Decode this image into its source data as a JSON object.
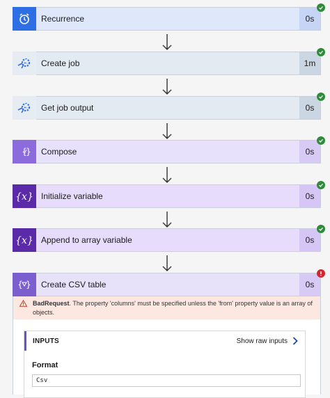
{
  "steps": [
    {
      "label": "Recurrence",
      "duration": "0s",
      "icon": "alarm-clock-icon",
      "status": "succeeded"
    },
    {
      "label": "Create job",
      "duration": "1m",
      "icon": "automation-gear-icon",
      "status": "succeeded"
    },
    {
      "label": "Get job output",
      "duration": "0s",
      "icon": "automation-gear-icon",
      "status": "succeeded"
    },
    {
      "label": "Compose",
      "duration": "0s",
      "icon": "compose-braces-icon",
      "status": "succeeded"
    },
    {
      "label": "Initialize variable",
      "duration": "0s",
      "icon": "variable-x-icon",
      "status": "succeeded"
    },
    {
      "label": "Append to array variable",
      "duration": "0s",
      "icon": "variable-x-icon",
      "status": "succeeded"
    },
    {
      "label": "Create CSV table",
      "duration": "0s",
      "icon": "csv-table-braces-icon",
      "status": "failed"
    }
  ],
  "error": {
    "title": "BadRequest",
    "message": ". The property 'columns' must be specified unless the 'from' property value is an array of objects."
  },
  "inputs": {
    "header": "INPUTS",
    "show_raw": "Show raw inputs",
    "format_label": "Format",
    "format_value": "Csv"
  },
  "colors": {
    "recurrence_icon": "#2f6fe6",
    "recurrence_bg": "#dfe8fb",
    "recurrence_dur": "#c6d5f6",
    "automation_icon_bg": "#e6ecf2",
    "automation_bg": "#e3eaf1",
    "automation_dur": "#cbd6e3",
    "compose_icon": "#8c6cdc",
    "compose_bg": "#e8e1fb",
    "compose_dur": "#d7cbf5",
    "variable_icon": "#5a2aa8",
    "variable_bg": "#e7dcfb",
    "variable_dur": "#d6c6f5",
    "csv_icon": "#7b5fcf",
    "csv_bg": "#e7e1fa",
    "csv_dur": "#d7cbf5",
    "success": "#2e8b3a",
    "error": "#d1282f"
  }
}
